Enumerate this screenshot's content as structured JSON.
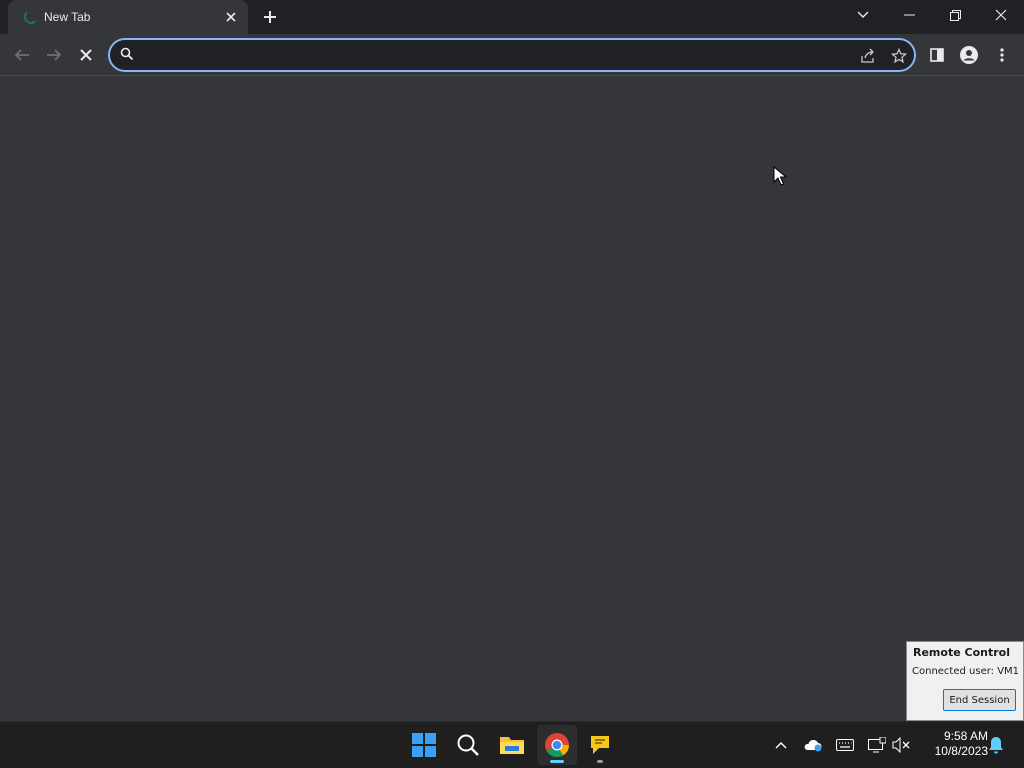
{
  "browser": {
    "tab": {
      "title": "New Tab",
      "loading": true
    },
    "omnibox": {
      "value": "",
      "placeholder": ""
    }
  },
  "remote_control": {
    "title": "Remote Control",
    "connected_user": "Connected user: VM1",
    "end_button": "End Session"
  },
  "taskbar": {
    "apps": [
      "start-icon",
      "search-icon",
      "file-explorer-icon",
      "chrome-icon",
      "chat-app-icon"
    ],
    "time": "9:58 AM",
    "date": "10/8/2023"
  },
  "colors": {
    "accent": "#8ab4f8",
    "content_bg": "#35363a",
    "tabstrip_bg": "#202124"
  }
}
